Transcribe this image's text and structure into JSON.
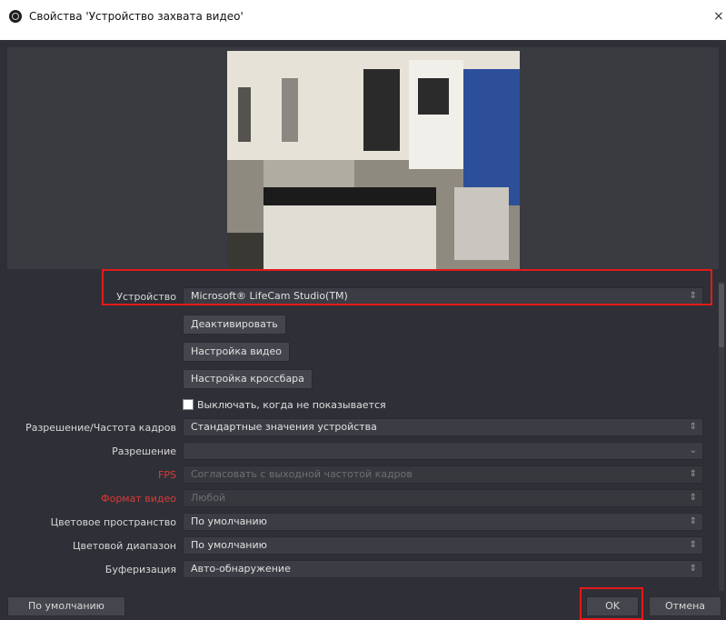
{
  "window": {
    "title": "Свойства 'Устройство захвата видео'",
    "close_glyph": "×"
  },
  "fields": {
    "device_label": "Устройство",
    "device_value": "Microsoft® LifeCam Studio(TM)",
    "deactivate_label": "Деактивировать",
    "video_settings_label": "Настройка видео",
    "crossbar_settings_label": "Настройка кроссбара",
    "deactivate_when_hidden_label": "Выключать, когда не показывается",
    "resolution_fps_type_label": "Разрешение/Частота кадров",
    "resolution_fps_type_value": "Стандартные значения устройства",
    "resolution_label": "Разрешение",
    "resolution_value": "",
    "fps_label": "FPS",
    "fps_value": "Согласовать с выходной частотой кадров",
    "video_format_label": "Формат видео",
    "video_format_value": "Любой",
    "color_space_label": "Цветовое пространство",
    "color_space_value": "По умолчанию",
    "color_range_label": "Цветовой диапазон",
    "color_range_value": "По умолчанию",
    "buffering_label": "Буферизация",
    "buffering_value": "Авто-обнаружение"
  },
  "buttons": {
    "defaults": "По умолчанию",
    "ok": "OK",
    "cancel": "Отмена"
  },
  "icons": {
    "spinner": "⇕",
    "dropdown": "⌄"
  },
  "colors": {
    "dialog_bg": "#2f3037",
    "highlight": "#e21a1a",
    "disabled_label": "#d93a3a"
  }
}
